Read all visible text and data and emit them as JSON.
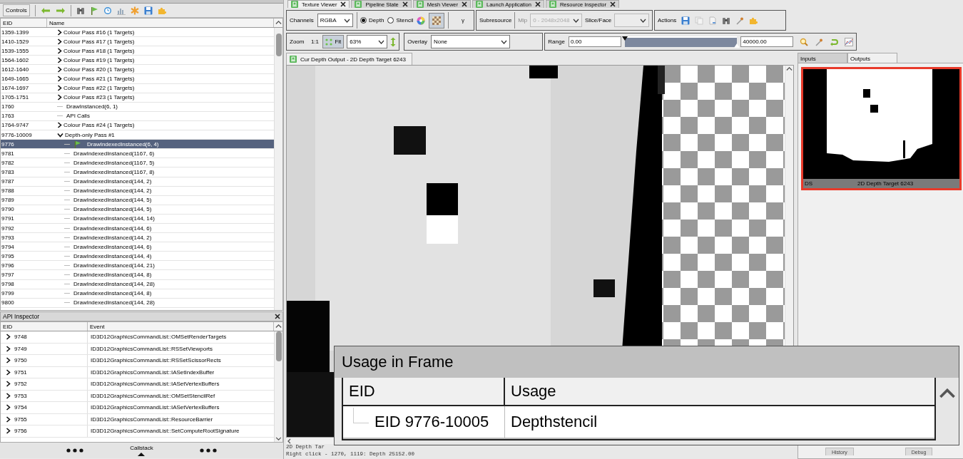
{
  "top_tabs": [
    {
      "label": "Texture Viewer",
      "selected": true
    },
    {
      "label": "Pipeline State",
      "selected": false
    },
    {
      "label": "Mesh Viewer",
      "selected": false
    },
    {
      "label": "Launch Application",
      "selected": false
    },
    {
      "label": "Resource Inspector",
      "selected": false
    }
  ],
  "event_browser": {
    "toolbar_label": "Controls",
    "columns": [
      "EID",
      "Name"
    ],
    "rows": [
      {
        "eid": "1359-1399",
        "name": "Colour Pass #16 (1 Targets)",
        "expanded": false,
        "selected": false,
        "bookmarked": false
      },
      {
        "eid": "1410-1529",
        "name": "Colour Pass #17 (1 Targets)",
        "expanded": false,
        "selected": false,
        "bookmarked": false
      },
      {
        "eid": "1539-1555",
        "name": "Colour Pass #18 (1 Targets)",
        "expanded": false,
        "selected": false,
        "bookmarked": false
      },
      {
        "eid": "1564-1602",
        "name": "Colour Pass #19 (1 Targets)",
        "expanded": false,
        "selected": false,
        "bookmarked": false
      },
      {
        "eid": "1612-1640",
        "name": "Colour Pass #20 (1 Targets)",
        "expanded": false,
        "selected": false,
        "bookmarked": false
      },
      {
        "eid": "1649-1665",
        "name": "Colour Pass #21 (1 Targets)",
        "expanded": false,
        "selected": false,
        "bookmarked": false
      },
      {
        "eid": "1674-1697",
        "name": "Colour Pass #22 (1 Targets)",
        "expanded": false,
        "selected": false,
        "bookmarked": false
      },
      {
        "eid": "1705-1751",
        "name": "Colour Pass #23 (1 Targets)",
        "expanded": false,
        "selected": false,
        "bookmarked": false
      },
      {
        "eid": "1760",
        "name": "DrawInstanced(6, 1)",
        "selected": false,
        "bookmarked": false
      },
      {
        "eid": "1763",
        "name": "API Calls",
        "selected": false,
        "bookmarked": false
      },
      {
        "eid": "1764-9747",
        "name": "Colour Pass #24 (1 Targets)",
        "expanded": false,
        "selected": false,
        "bookmarked": false
      },
      {
        "eid": "9776-10009",
        "name": "Depth-only Pass #1",
        "expanded": true,
        "selected": false,
        "bookmarked": false,
        "children": [
          {
            "eid": "9776",
            "name": "DrawIndexedInstanced(6, 4)",
            "selected": true,
            "bookmarked": true
          },
          {
            "eid": "9781",
            "name": "DrawIndexedInstanced(1167, 6)",
            "selected": false,
            "bookmarked": false
          },
          {
            "eid": "9782",
            "name": "DrawIndexedInstanced(1167, 5)",
            "selected": false,
            "bookmarked": false
          },
          {
            "eid": "9783",
            "name": "DrawIndexedInstanced(1167, 8)",
            "selected": false,
            "bookmarked": false
          },
          {
            "eid": "9787",
            "name": "DrawIndexedInstanced(144, 2)",
            "selected": false,
            "bookmarked": false
          },
          {
            "eid": "9788",
            "name": "DrawIndexedInstanced(144, 2)",
            "selected": false,
            "bookmarked": false
          },
          {
            "eid": "9789",
            "name": "DrawIndexedInstanced(144, 5)",
            "selected": false,
            "bookmarked": false
          },
          {
            "eid": "9790",
            "name": "DrawIndexedInstanced(144, 5)",
            "selected": false,
            "bookmarked": false
          },
          {
            "eid": "9791",
            "name": "DrawIndexedInstanced(144, 14)",
            "selected": false,
            "bookmarked": false
          },
          {
            "eid": "9792",
            "name": "DrawIndexedInstanced(144, 6)",
            "selected": false,
            "bookmarked": false
          },
          {
            "eid": "9793",
            "name": "DrawIndexedInstanced(144, 2)",
            "selected": false,
            "bookmarked": false
          },
          {
            "eid": "9794",
            "name": "DrawIndexedInstanced(144, 6)",
            "selected": false,
            "bookmarked": false
          },
          {
            "eid": "9795",
            "name": "DrawIndexedInstanced(144, 4)",
            "selected": false,
            "bookmarked": false
          },
          {
            "eid": "9796",
            "name": "DrawIndexedInstanced(144, 21)",
            "selected": false,
            "bookmarked": false
          },
          {
            "eid": "9797",
            "name": "DrawIndexedInstanced(144, 8)",
            "selected": false,
            "bookmarked": false
          },
          {
            "eid": "9798",
            "name": "DrawIndexedInstanced(144, 28)",
            "selected": false,
            "bookmarked": false
          },
          {
            "eid": "9799",
            "name": "DrawIndexedInstanced(144, 8)",
            "selected": false,
            "bookmarked": false
          },
          {
            "eid": "9800",
            "name": "DrawIndexedInstanced(144, 28)",
            "selected": false,
            "bookmarked": false
          }
        ]
      }
    ]
  },
  "api_inspector": {
    "title": "API Inspector",
    "columns": [
      "EID",
      "Event"
    ],
    "rows": [
      {
        "eid": "9748",
        "event": "ID3D12GraphicsCommandList::OMSetRenderTargets"
      },
      {
        "eid": "9749",
        "event": "ID3D12GraphicsCommandList::RSSetViewports"
      },
      {
        "eid": "9750",
        "event": "ID3D12GraphicsCommandList::RSSetScissorRects"
      },
      {
        "eid": "9751",
        "event": "ID3D12GraphicsCommandList::IASetIndexBuffer"
      },
      {
        "eid": "9752",
        "event": "ID3D12GraphicsCommandList::IASetVertexBuffers"
      },
      {
        "eid": "9753",
        "event": "ID3D12GraphicsCommandList::OMSetStencilRef"
      },
      {
        "eid": "9754",
        "event": "ID3D12GraphicsCommandList::IASetVertexBuffers"
      },
      {
        "eid": "9755",
        "event": "ID3D12GraphicsCommandList::ResourceBarrier"
      },
      {
        "eid": "9756",
        "event": "ID3D12GraphicsCommandList::SetComputeRootSignature"
      }
    ],
    "footer": "Callstack"
  },
  "texture_toolbar": {
    "channels_label": "Channels",
    "channels": "RGBA",
    "radios": [
      {
        "label": "Depth",
        "selected": true
      },
      {
        "label": "Stencil",
        "selected": false
      }
    ],
    "checkerboard": {
      "on": true
    },
    "gamma": "γ",
    "subresource_label": "Subresource",
    "mip_label": "Mip",
    "mip": {
      "value": "0 - 2048x2048",
      "disabled": true
    },
    "slice_label": "Slice/Face",
    "slice": {
      "disabled": true
    },
    "actions_label": "Actions",
    "zoom_label": "Zoom",
    "zoom_1to1": "1:1",
    "fit": {
      "label": "Fit",
      "on": true
    },
    "zoom": "63%",
    "overlay_label": "Overlay",
    "overlay": "None",
    "range": {
      "label": "Range",
      "min": "0.00",
      "level": 1,
      "max": "40000.00"
    }
  },
  "doc_tab": "Cur Depth Output - 2D Depth Target 6243",
  "status": [
    "2D Depth Tar",
    "Right click - 1270, 1119: Depth 25152.00"
  ],
  "thumbnails": {
    "tabs": [
      {
        "label": "Inputs",
        "selected": false
      },
      {
        "label": "Outputs",
        "selected": true
      }
    ],
    "items": [
      {
        "type": "DS",
        "name": "2D Depth Target 6243",
        "selected": true
      }
    ],
    "buttons": [
      "History",
      "Debug"
    ]
  },
  "usage_popup": {
    "title": "Usage in Frame",
    "columns": [
      "EID",
      "Usage"
    ],
    "rows": [
      {
        "eid": "EID 9776-10005",
        "usage": "Depthstencil"
      }
    ]
  }
}
